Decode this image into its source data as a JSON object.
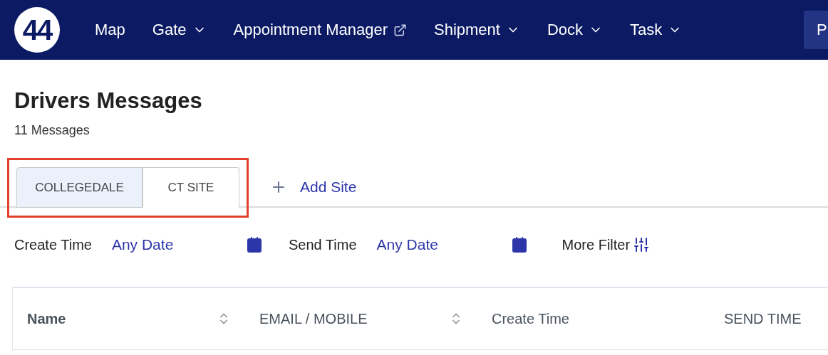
{
  "nav": {
    "logo": "44",
    "items": [
      {
        "label": "Map",
        "kind": "plain"
      },
      {
        "label": "Gate",
        "kind": "dropdown"
      },
      {
        "label": "Appointment Manager",
        "kind": "external"
      },
      {
        "label": "Shipment",
        "kind": "dropdown"
      },
      {
        "label": "Dock",
        "kind": "dropdown"
      },
      {
        "label": "Task",
        "kind": "dropdown"
      }
    ],
    "cut_button": "P"
  },
  "page": {
    "title": "Drivers Messages",
    "count": "11 Messages"
  },
  "tabs": [
    {
      "label": "COLLEGEDALE",
      "selected": false
    },
    {
      "label": "CT SITE",
      "selected": true
    }
  ],
  "tabs_highlighted": true,
  "add_site": "Add Site",
  "filters": [
    {
      "label": "Create Time",
      "value": "Any Date"
    },
    {
      "label": "Send Time",
      "value": "Any Date"
    }
  ],
  "more_filter": "More Filter",
  "table": {
    "columns": [
      {
        "label": "Name",
        "sortable": true
      },
      {
        "label": "EMAIL / MOBILE",
        "sortable": true
      },
      {
        "label": "Create Time"
      },
      {
        "label": "SEND TIME"
      }
    ]
  }
}
